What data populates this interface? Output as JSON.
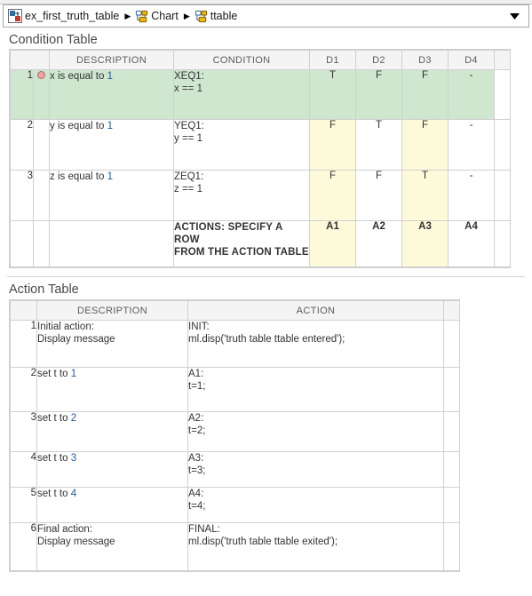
{
  "breadcrumb": {
    "items": [
      {
        "label": "ex_first_truth_table",
        "icon": "simulink-model-icon"
      },
      {
        "label": "Chart",
        "icon": "stateflow-chart-icon"
      },
      {
        "label": "ttable",
        "icon": "truth-table-icon"
      }
    ],
    "separator": "▶",
    "dropdown_icon": "chevron-down-icon"
  },
  "colors": {
    "highlight_green": "#cfe6cf",
    "highlight_yellow": "#fcfad9",
    "breakpoint_red": "#f2a2a0",
    "link_blue": "#1d5a9e"
  },
  "condition_table": {
    "title": "Condition Table",
    "columns": [
      "",
      "DESCRIPTION",
      "CONDITION",
      "D1",
      "D2",
      "D3",
      "D4",
      ""
    ],
    "rows": [
      {
        "number": "1",
        "breakpoint": true,
        "highlighted": true,
        "description": "x is equal to 1",
        "condition_label": "XEQ1:",
        "condition_expr": "x == 1",
        "decisions": [
          "T",
          "F",
          "F",
          "-"
        ],
        "decision_highlight": [
          false,
          false,
          false,
          false
        ]
      },
      {
        "number": "2",
        "breakpoint": false,
        "highlighted": false,
        "description": "y is equal to 1",
        "condition_label": "YEQ1:",
        "condition_expr": "y == 1",
        "decisions": [
          "F",
          "T",
          "F",
          "-"
        ],
        "decision_highlight": [
          true,
          false,
          true,
          false
        ]
      },
      {
        "number": "3",
        "breakpoint": false,
        "highlighted": false,
        "description": "z is equal to 1",
        "condition_label": "ZEQ1:",
        "condition_expr": "z == 1",
        "decisions": [
          "F",
          "F",
          "T",
          "-"
        ],
        "decision_highlight": [
          true,
          false,
          true,
          false
        ]
      }
    ],
    "actions_row": {
      "label_line1": "ACTIONS: SPECIFY A ROW",
      "label_line2": "FROM THE ACTION TABLE",
      "actions": [
        "A1",
        "A2",
        "A3",
        "A4"
      ],
      "action_highlight": [
        true,
        false,
        true,
        false
      ]
    }
  },
  "action_table": {
    "title": "Action Table",
    "columns": [
      "",
      "DESCRIPTION",
      "ACTION",
      ""
    ],
    "rows": [
      {
        "number": "1",
        "desc_line1": "Initial action:",
        "desc_line2": "Display message",
        "action_label": "INIT:",
        "action_code": "ml.disp('truth table ttable entered');"
      },
      {
        "number": "2",
        "desc_line1": "set t to 1",
        "desc_line2": "",
        "action_label": "A1:",
        "action_code": "t=1;"
      },
      {
        "number": "3",
        "desc_line1": "set t to 2",
        "desc_line2": "",
        "action_label": "A2:",
        "action_code": "t=2;"
      },
      {
        "number": "4",
        "desc_line1": "set t to 3",
        "desc_line2": "",
        "action_label": "A3:",
        "action_code": "t=3;"
      },
      {
        "number": "5",
        "desc_line1": "set t to 4",
        "desc_line2": "",
        "action_label": "A4:",
        "action_code": "t=4;"
      },
      {
        "number": "6",
        "desc_line1": "Final action:",
        "desc_line2": "Display message",
        "action_label": "FINAL:",
        "action_code": "ml.disp('truth table ttable exited');"
      }
    ]
  }
}
